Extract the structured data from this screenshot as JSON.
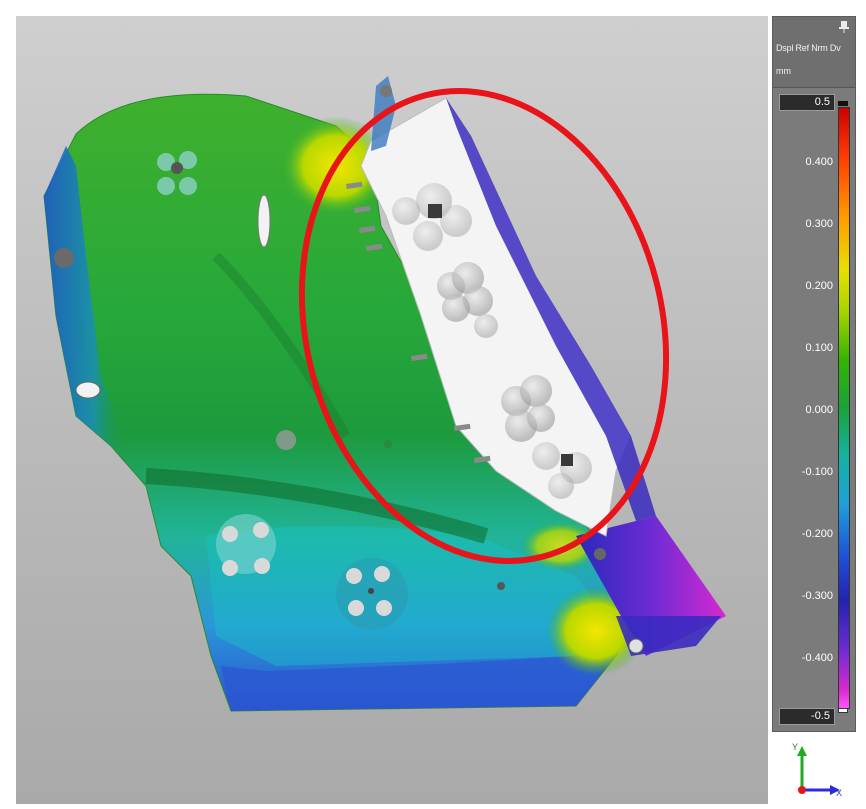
{
  "legend": {
    "title": "Dspl Ref Nrm Dv",
    "unit": "mm",
    "max_value": "0.5",
    "min_value": "-0.5",
    "ticks": [
      "0.400",
      "0.300",
      "0.200",
      "0.100",
      "0.000",
      "-0.100",
      "-0.200",
      "-0.300",
      "-0.400"
    ]
  },
  "axis_triad": {
    "y_label": "Y",
    "x_label": "X"
  },
  "colors": {
    "highlight_ellipse": "#e8141a",
    "viewport_background": "#bdbdbd",
    "legend_background": "#7b7b7b"
  },
  "icons": [
    "pin-icon",
    "axis-triad-icon"
  ]
}
